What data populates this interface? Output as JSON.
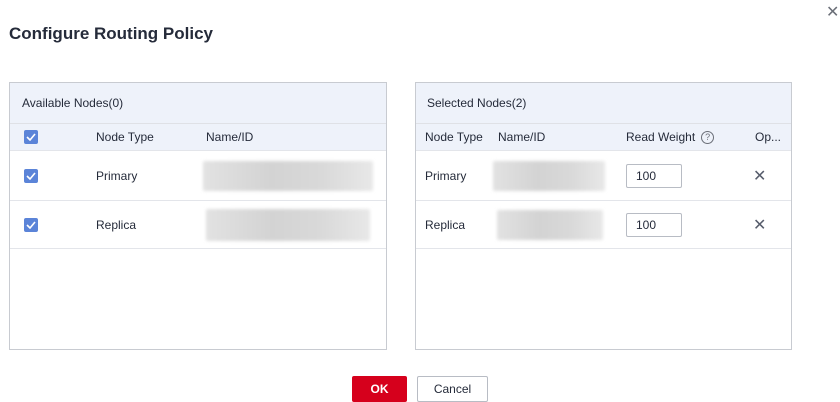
{
  "dialog": {
    "title": "Configure Routing Policy",
    "close_icon": "close-icon"
  },
  "available": {
    "header": "Available Nodes(0)",
    "columns": [
      "Node Type",
      "Name/ID"
    ],
    "rows": [
      {
        "checked": true,
        "type": "Primary"
      },
      {
        "checked": true,
        "type": "Replica"
      }
    ]
  },
  "selected": {
    "header": "Selected Nodes(2)",
    "columns": [
      "Node Type",
      "Name/ID",
      "Read Weight",
      "Op..."
    ],
    "help_icon": "question-circle-icon",
    "rows": [
      {
        "type": "Primary",
        "weight": "100"
      },
      {
        "type": "Replica",
        "weight": "100"
      }
    ]
  },
  "footer": {
    "ok_label": "OK",
    "cancel_label": "Cancel"
  },
  "colors": {
    "accent": "#5b84d8",
    "primary_button": "#d6001c",
    "header_bg": "#eef2fa"
  }
}
